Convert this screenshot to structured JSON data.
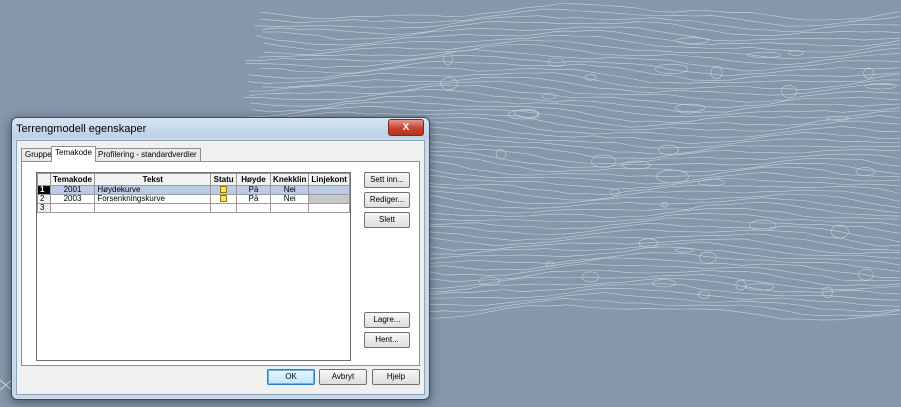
{
  "dialog": {
    "title": "Terrengmodell egenskaper",
    "close_label": "X"
  },
  "tabs": [
    {
      "label": "Gruppe"
    },
    {
      "label": "Temakode"
    },
    {
      "label": "Profilering - standardverdier"
    }
  ],
  "active_tab": "Temakode",
  "table": {
    "headers": [
      "Temakode",
      "Tekst",
      "Statu",
      "Høyde",
      "Knekklin",
      "Linjekont"
    ],
    "rows": [
      {
        "num": "1",
        "temakode": "2001",
        "tekst": "Høydekurve",
        "status": "on",
        "hoyde": "På",
        "knekklin": "Nei",
        "linjekont": ""
      },
      {
        "num": "2",
        "temakode": "2003",
        "tekst": "Forsenkningskurve",
        "status": "on",
        "hoyde": "På",
        "knekklin": "Nei",
        "linjekont": ""
      },
      {
        "num": "3",
        "temakode": "",
        "tekst": "",
        "status": "",
        "hoyde": "",
        "knekklin": "",
        "linjekont": ""
      }
    ]
  },
  "side_buttons": {
    "insert": "Sett inn...",
    "edit": "Rediger...",
    "delete": "Slett",
    "save": "Lagre...",
    "load": "Hent..."
  },
  "bottom_buttons": {
    "ok": "OK",
    "cancel": "Avbryt",
    "help": "Hjelp"
  },
  "colors": {
    "viewport_background": "#8497ab",
    "contour_lines": "#d8dde3",
    "selected_row": "#b9cbe6",
    "status_indicator": "#f5e84a"
  }
}
